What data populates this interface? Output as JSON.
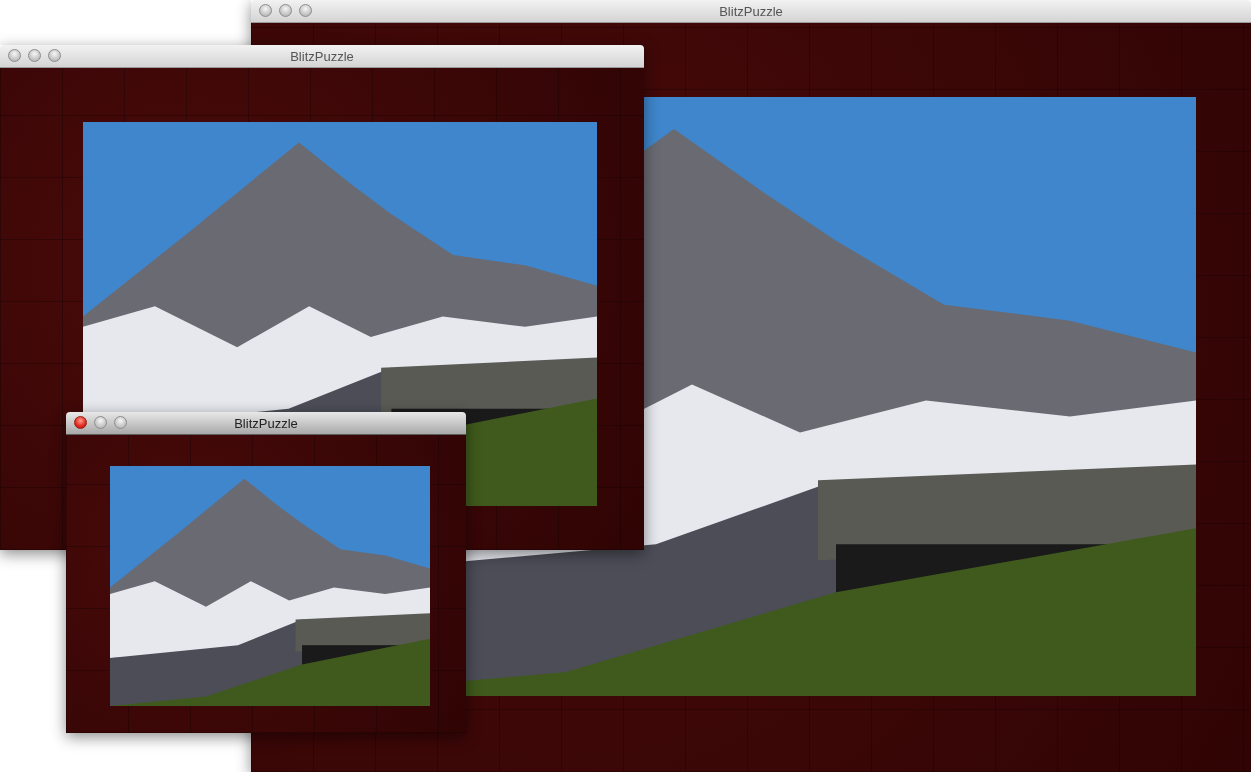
{
  "windows": [
    {
      "title": "BlitzPuzzle",
      "active": false
    },
    {
      "title": "BlitzPuzzle",
      "active": false
    },
    {
      "title": "BlitzPuzzle",
      "active": true
    }
  ]
}
